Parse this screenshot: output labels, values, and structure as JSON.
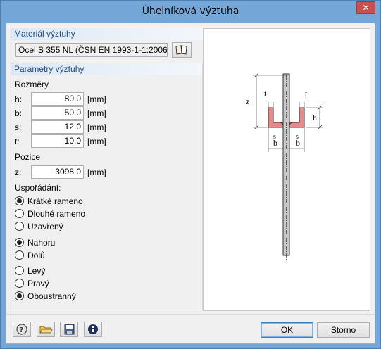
{
  "window": {
    "title": "Úhelníková výztuha",
    "close_label": "✕"
  },
  "material": {
    "group_label": "Materiál výztuhy",
    "value": "Ocel S 355 NL (ČSN EN 1993-1-1:2006)"
  },
  "params": {
    "group_label": "Parametry výztuhy",
    "dimensions_label": "Rozměry",
    "fields": [
      {
        "label": "h:",
        "value": "80.0",
        "unit": "[mm]"
      },
      {
        "label": "b:",
        "value": "50.0",
        "unit": "[mm]"
      },
      {
        "label": "s:",
        "value": "12.0",
        "unit": "[mm]"
      },
      {
        "label": "t:",
        "value": "10.0",
        "unit": "[mm]"
      }
    ],
    "position_label": "Pozice",
    "z": {
      "label": "z:",
      "value": "3098.0",
      "unit": "[mm]"
    },
    "arrangement_label": "Uspořádání:",
    "leg_options": [
      "Krátké rameno",
      "Dlouhé rameno",
      "Uzavřený"
    ],
    "leg_selected": 0,
    "direction_options": [
      "Nahoru",
      "Dolů"
    ],
    "direction_selected": 0,
    "side_options": [
      "Levý",
      "Pravý",
      "Oboustranný"
    ],
    "side_selected": 2
  },
  "diagram": {
    "z": "z",
    "t_left": "t",
    "t_right": "t",
    "h": "h",
    "s_left": "s",
    "s_right": "s",
    "b_left": "b",
    "b_right": "b"
  },
  "buttons": {
    "ok": "OK",
    "cancel": "Storno"
  }
}
